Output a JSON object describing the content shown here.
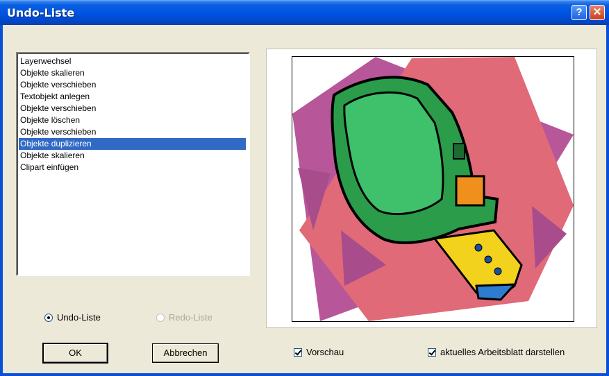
{
  "window": {
    "title": "Undo-Liste",
    "help_label": "?",
    "close_label": "✕"
  },
  "list": {
    "items": [
      "Layerwechsel",
      "Objekte skalieren",
      "Objekte verschieben",
      "Textobjekt anlegen",
      "Objekte verschieben",
      "Objekte löschen",
      "Objekte verschieben",
      "Objekte duplizieren",
      "Objekte skalieren",
      "Clipart einfügen"
    ],
    "selected_index": 7
  },
  "radios": {
    "undo": "Undo-Liste",
    "redo": "Redo-Liste"
  },
  "buttons": {
    "ok": "OK",
    "cancel": "Abbrechen"
  },
  "checkboxes": {
    "preview": "Vorschau",
    "current_sheet": "aktuelles Arbeitsblatt darstellen"
  },
  "colors": {
    "title_bar": "#0054e3",
    "selection": "#316ac5",
    "dialog_bg": "#ece9d8"
  },
  "preview_image": {
    "subject": "tape-measure-clipart"
  }
}
